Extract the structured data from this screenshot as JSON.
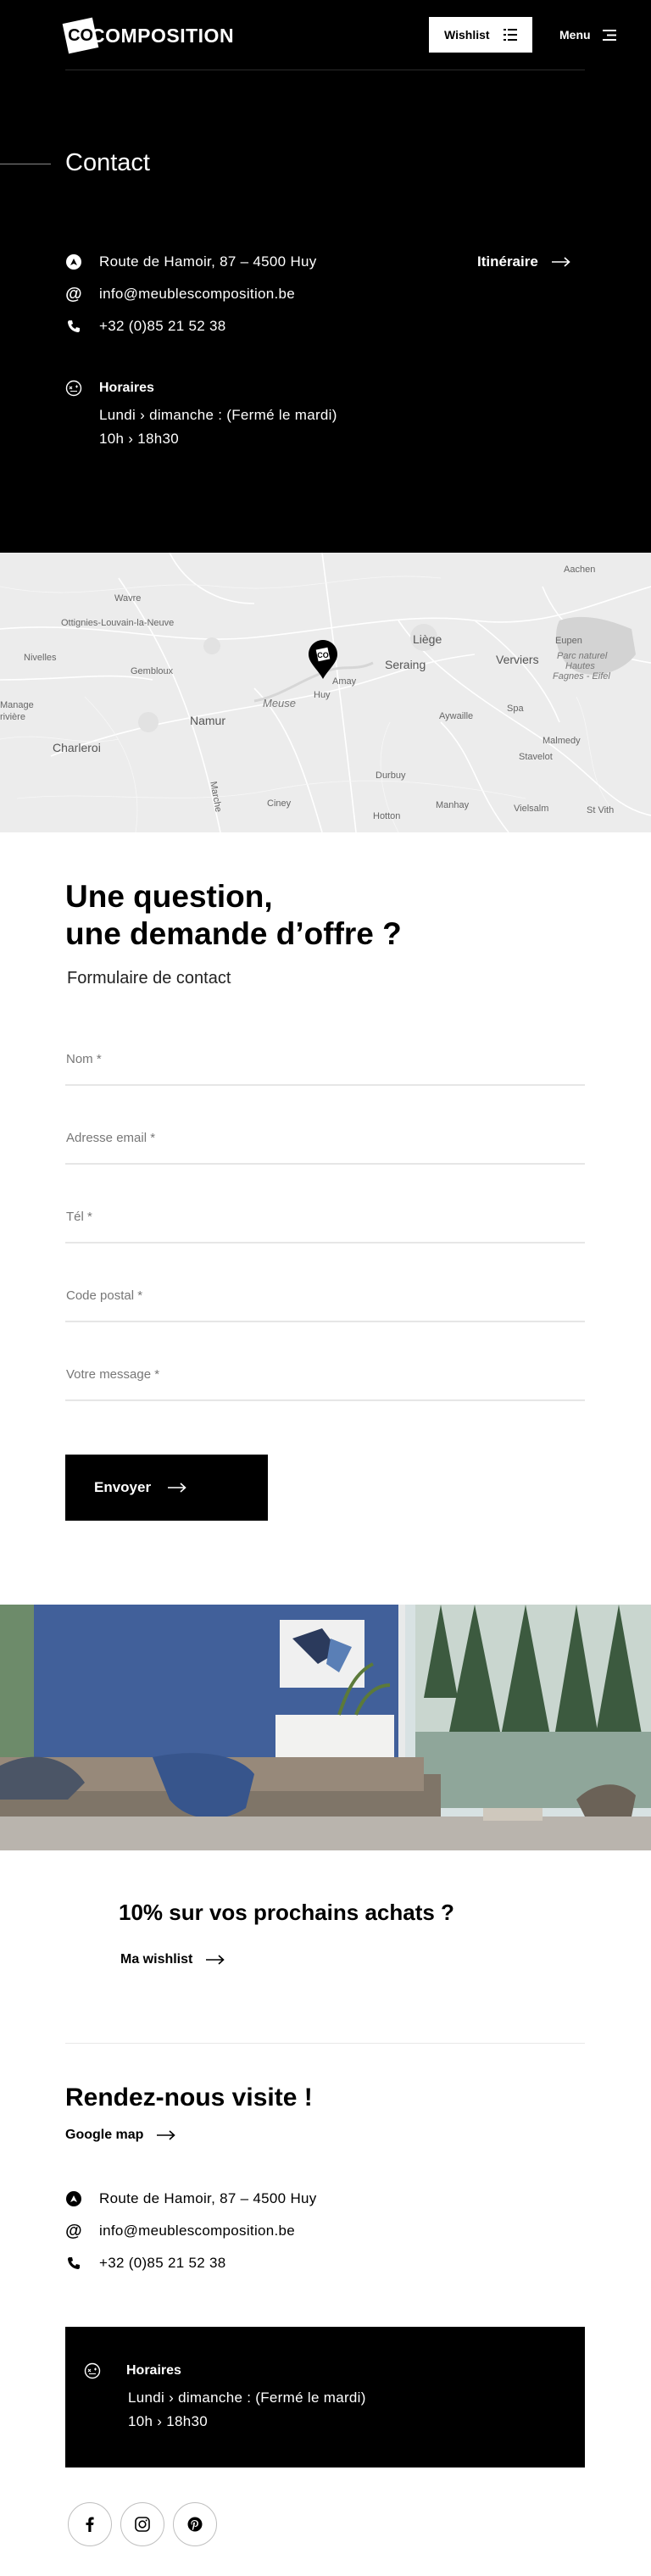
{
  "header": {
    "logo_letters": "CO",
    "logo_text": "COMPOSITION",
    "wishlist_label": "Wishlist",
    "menu_label": "Menu"
  },
  "contact": {
    "title": "Contact",
    "address": "Route de Hamoir, 87 – 4500 Huy",
    "email": "info@meublescomposition.be",
    "phone": "+32 (0)85 21 52 38",
    "itinerary_label": "Itinéraire",
    "hours": {
      "label": "Horaires",
      "days": "Lundi › dimanche :  (Fermé le mardi)",
      "time": "10h › 18h30"
    }
  },
  "map": {
    "labels": [
      "Aachen",
      "Wavre",
      "Ottignies-Louvain-la-Neuve",
      "Nivelles",
      "Gembloux",
      "Liège",
      "Eupen",
      "Verviers",
      "Seraing",
      "Parc naturel",
      "Hautes",
      "Fagnes - Eifel",
      "Namur",
      "Meuse",
      "Huy",
      "Amay",
      "Aywaille",
      "Spa",
      "Manage",
      "rivière",
      "Charleroi",
      "Malmedy",
      "Stavelot",
      "Durbuy",
      "Ciney",
      "Marche",
      "Hotton",
      "Manhay",
      "Vielsalm",
      "St Vith"
    ],
    "marker_icon": "map-pin-icon"
  },
  "form": {
    "title_line1": "Une question,",
    "title_line2": "une demande d’offre ?",
    "subtitle": "Formulaire de contact",
    "fields": [
      {
        "label": "Nom *"
      },
      {
        "label": "Adresse email *"
      },
      {
        "label": "Tél *"
      },
      {
        "label": "Code postal *"
      },
      {
        "label": "Votre message *"
      }
    ],
    "submit_label": "Envoyer"
  },
  "promo": {
    "title": "10% sur vos prochains achats ?",
    "link_label": "Ma wishlist"
  },
  "visit": {
    "title": "Rendez-nous visite !",
    "gmap_label": "Google map",
    "address": "Route de Hamoir, 87 – 4500 Huy",
    "email": "info@meublescomposition.be",
    "phone": "+32 (0)85 21 52 38",
    "hours": {
      "label": "Horaires",
      "days": "Lundi › dimanche :  (Fermé le mardi)",
      "time": "10h › 18h30"
    }
  },
  "socials": [
    "facebook-icon",
    "instagram-icon",
    "pinterest-icon"
  ],
  "colors": {
    "hero_bg": "#000000",
    "map_bg": "#ececec",
    "button_bg": "#000000",
    "field_border": "#e6e6e6"
  }
}
